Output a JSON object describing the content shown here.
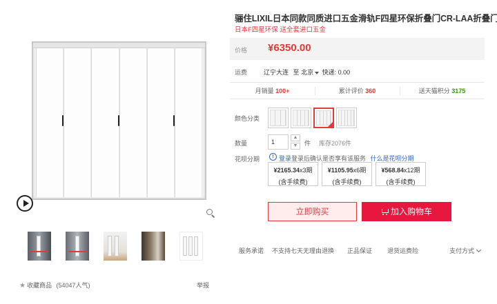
{
  "product": {
    "title": "骊住LIXIL日本同款同质进口五金滑轨F四星环保折叠门CR-LAA折叠门",
    "subtitle": "日本F四星环保 送全套进口五金"
  },
  "price": {
    "label": "价格",
    "value": "¥6350.00"
  },
  "shipping": {
    "label": "运费",
    "from": "辽宁大连",
    "to_prefix": "至",
    "to": "北京",
    "express": "快递: 0.00"
  },
  "stats": [
    {
      "label": "月销量",
      "value": "100+",
      "color": "#e4393c"
    },
    {
      "label": "累计评价",
      "value": "360",
      "color": "#e4393c"
    },
    {
      "label": "送天猫积分",
      "value": "3175",
      "color": "#339900"
    }
  ],
  "color_option": {
    "label": "颜色分类",
    "selected_index": 2
  },
  "quantity": {
    "label": "数量",
    "value": "1",
    "unit": "件",
    "stock": "库存2076件"
  },
  "huabei": {
    "label": "花呗分期",
    "note_prefix": "登录后确认是否享有该服务",
    "link": "什么是花呗分期",
    "plans": [
      {
        "amount": "¥2165.34",
        "periods": "x3期",
        "fee": "(含手续费)"
      },
      {
        "amount": "¥1105.95",
        "periods": "x6期",
        "fee": "(含手续费)"
      },
      {
        "amount": "¥568.84",
        "periods": "x12期",
        "fee": "(含手续费)"
      }
    ]
  },
  "actions": {
    "buy_now": "立即购买",
    "add_cart": "加入购物车"
  },
  "services": {
    "label": "服务承诺",
    "items": [
      "不支持七天无理由退换",
      "正品保证",
      "退货运费险"
    ],
    "pay": "支付方式"
  },
  "gallery": {
    "favorite": "收藏商品",
    "popularity": "(54047人气)",
    "report": "举报"
  },
  "colors": {
    "accent": "#e4393c",
    "green": "#339900",
    "link": "#3366cc"
  }
}
